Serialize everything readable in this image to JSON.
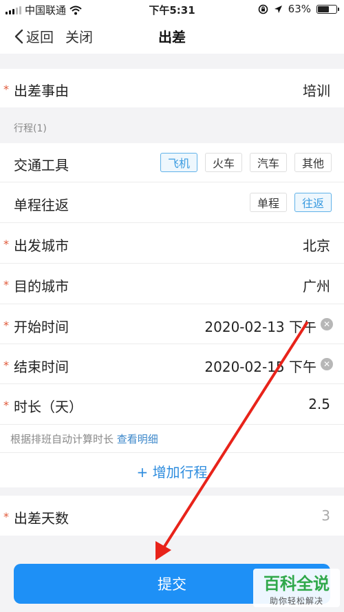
{
  "status_bar": {
    "carrier": "中国联通",
    "time": "下午5:31",
    "battery": "63%",
    "battery_level": 0.63
  },
  "nav": {
    "back_label": "返回",
    "close_label": "关闭",
    "title": "出差"
  },
  "reason": {
    "label": "出差事由",
    "value": "培训"
  },
  "trip_section": {
    "title": "行程(1)"
  },
  "transport": {
    "label": "交通工具",
    "options": [
      "飞机",
      "火车",
      "汽车",
      "其他"
    ],
    "selected": "飞机"
  },
  "round_trip": {
    "label": "单程往返",
    "options": [
      "单程",
      "往返"
    ],
    "selected": "往返"
  },
  "depart_city": {
    "label": "出发城市",
    "value": "北京"
  },
  "dest_city": {
    "label": "目的城市",
    "value": "广州"
  },
  "start_time": {
    "label": "开始时间",
    "value": "2020-02-13 下午"
  },
  "end_time": {
    "label": "结束时间",
    "value": "2020-02-15 下午"
  },
  "duration": {
    "label": "时长（天）",
    "value": "2.5"
  },
  "hint": {
    "text": "根据排班自动计算时长",
    "link": "查看明细"
  },
  "add_trip": {
    "icon": "+",
    "label": "增加行程"
  },
  "trip_days": {
    "label": "出差天数",
    "value": "3"
  },
  "submit": {
    "label": "提交"
  },
  "watermark": {
    "title": "百科全说",
    "subtitle": "助你轻松解决"
  },
  "colors": {
    "accent": "#1e90f6",
    "required": "#e05a3a",
    "annotation_arrow": "#e8231a"
  }
}
